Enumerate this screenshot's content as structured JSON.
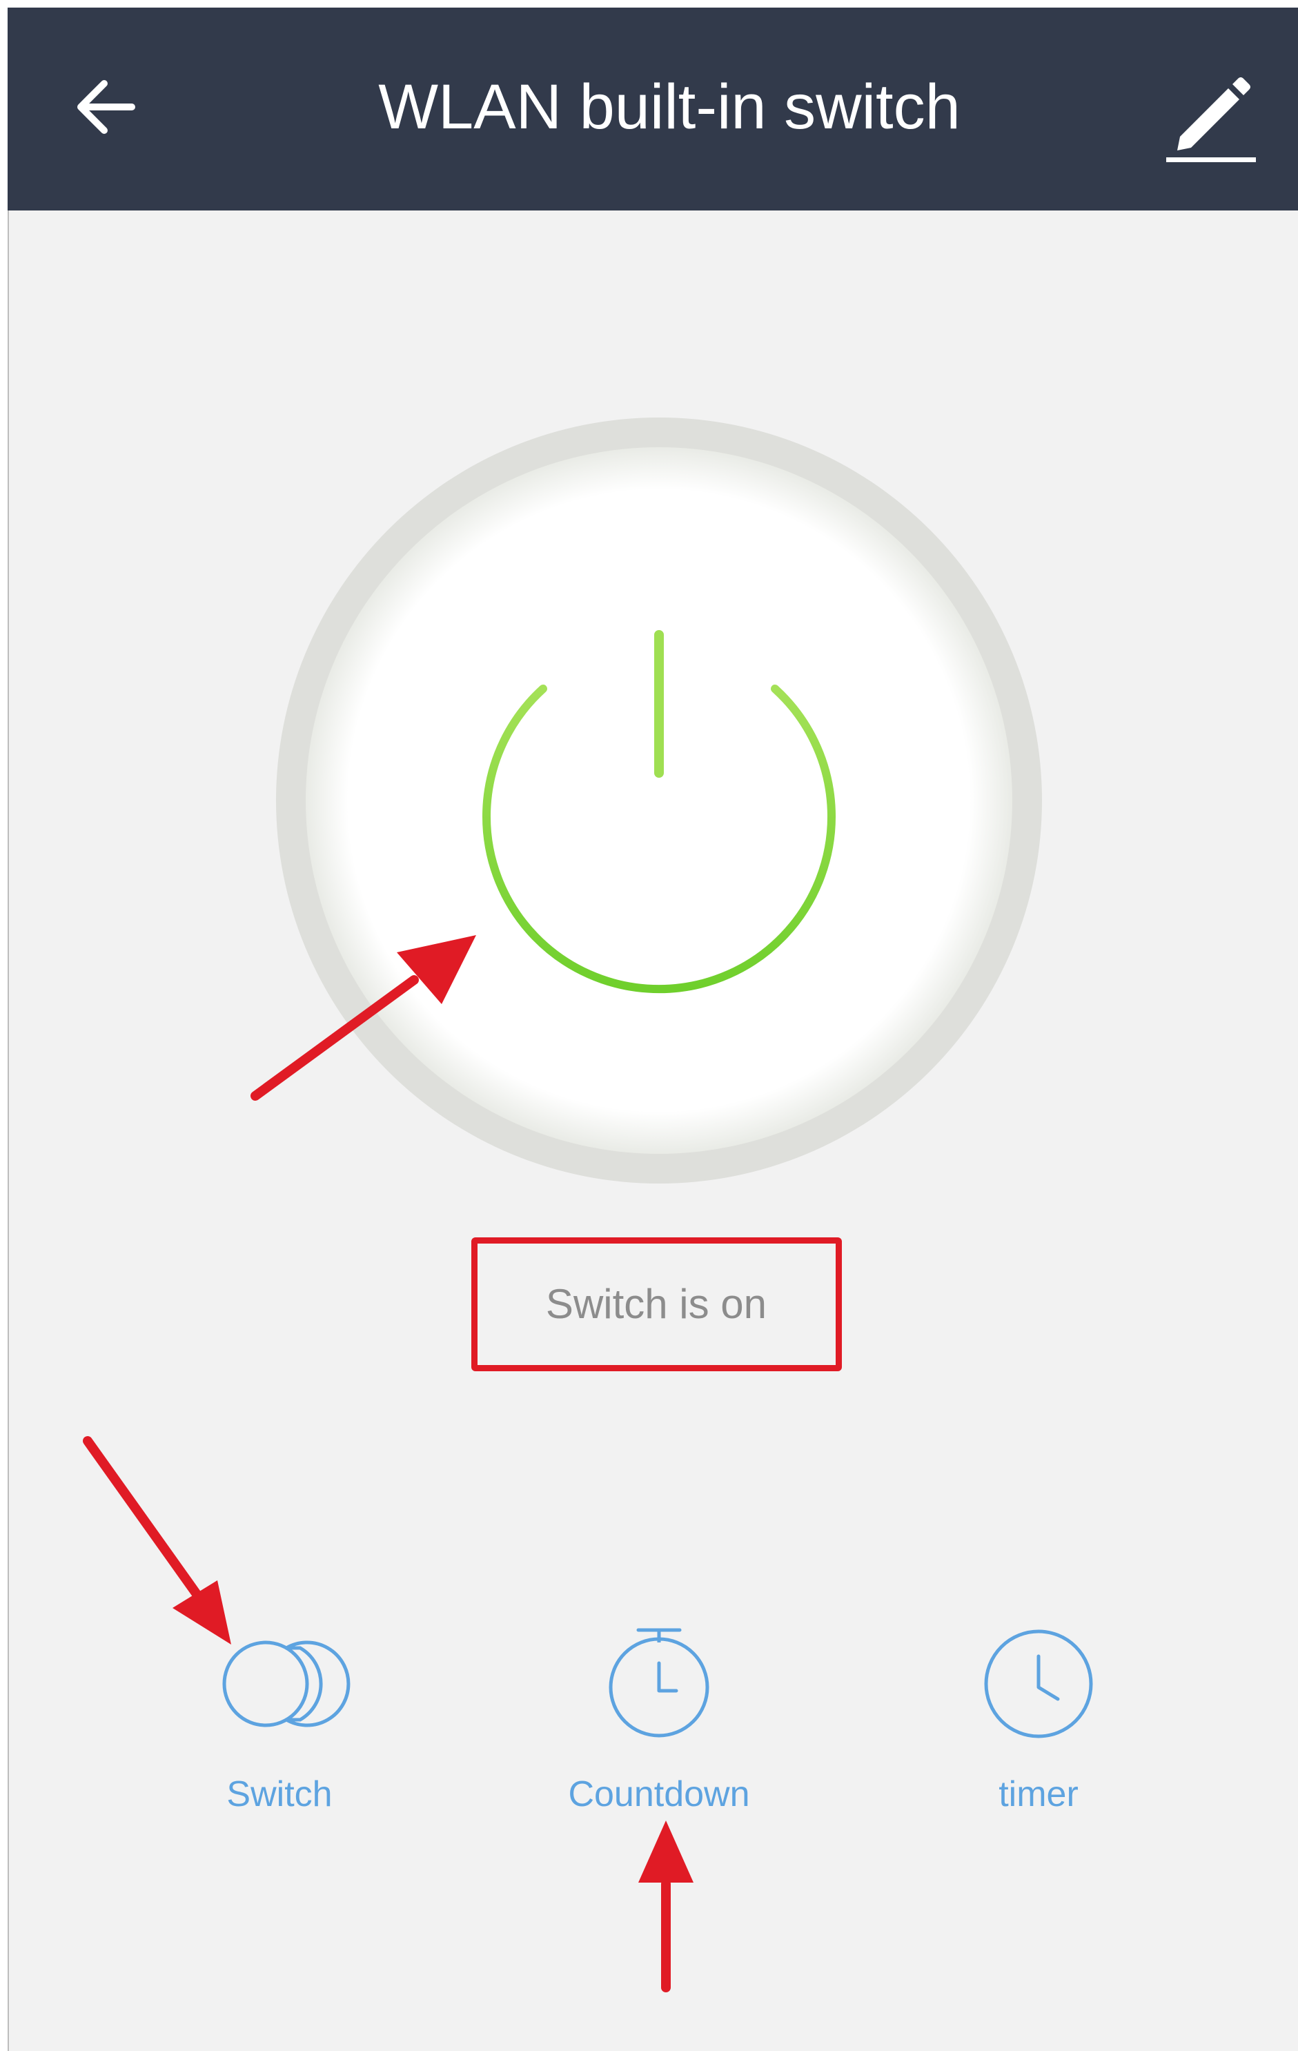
{
  "header": {
    "title": "WLAN built-in switch",
    "back_icon": "arrow-left-icon",
    "edit_icon": "pencil-icon",
    "background": "#323a4b"
  },
  "power": {
    "icon": "power-icon",
    "state": "on",
    "color": "#7dd23a"
  },
  "status": {
    "text": "Switch is on"
  },
  "actions": [
    {
      "label": "Switch",
      "icon": "toggle-icon"
    },
    {
      "label": "Countdown",
      "icon": "stopwatch-icon"
    },
    {
      "label": "timer",
      "icon": "clock-icon"
    }
  ],
  "annotations": {
    "color": "#e01b25",
    "items": [
      "arrow-to-power",
      "box-around-status",
      "arrow-to-switch",
      "arrow-to-countdown"
    ]
  }
}
